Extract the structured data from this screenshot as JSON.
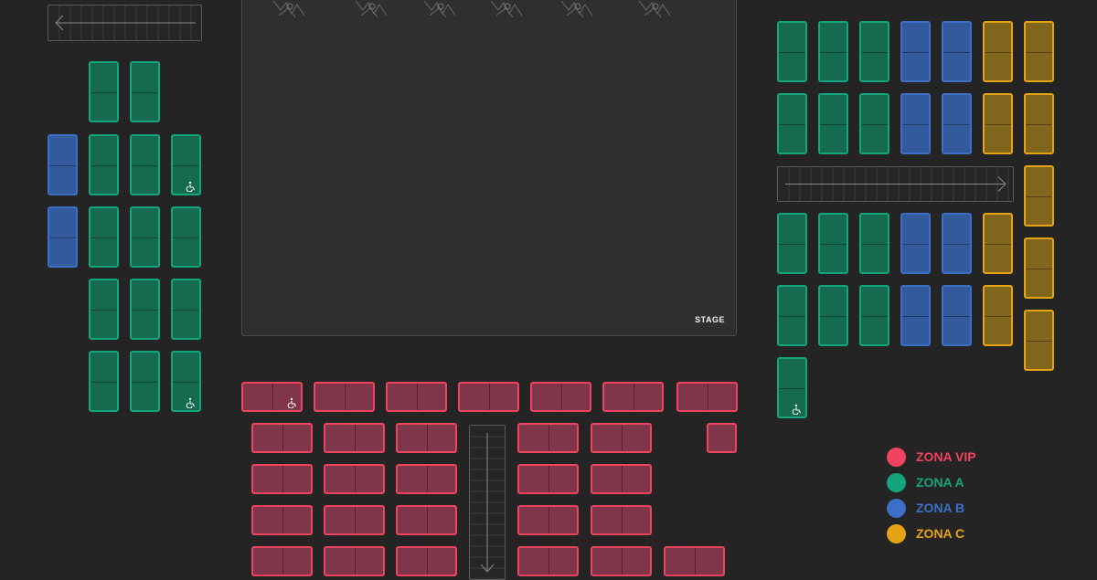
{
  "stage": {
    "label": "STAGE"
  },
  "legend": [
    {
      "key": "vip",
      "label": "ZONA VIP",
      "color": "#f0435f"
    },
    {
      "key": "a",
      "label": "ZONA A",
      "color": "#13a67c"
    },
    {
      "key": "b",
      "label": "ZONA B",
      "color": "#3c6fc6"
    },
    {
      "key": "c",
      "label": "ZONA C",
      "color": "#e6a313"
    }
  ],
  "zone_styles": {
    "vip": {
      "fill": "#80364a",
      "border": "#f0435f"
    },
    "a": {
      "fill": "#156a50",
      "border": "#13a67c"
    },
    "b": {
      "fill": "#345a9e",
      "border": "#3c6fc6"
    },
    "c": {
      "fill": "#80651d",
      "border": "#e6a313"
    }
  },
  "icons": {
    "accessible": "wheelchair-icon",
    "aisle_arrow": "arrow-icon",
    "stage_art": "stage-artwork"
  }
}
